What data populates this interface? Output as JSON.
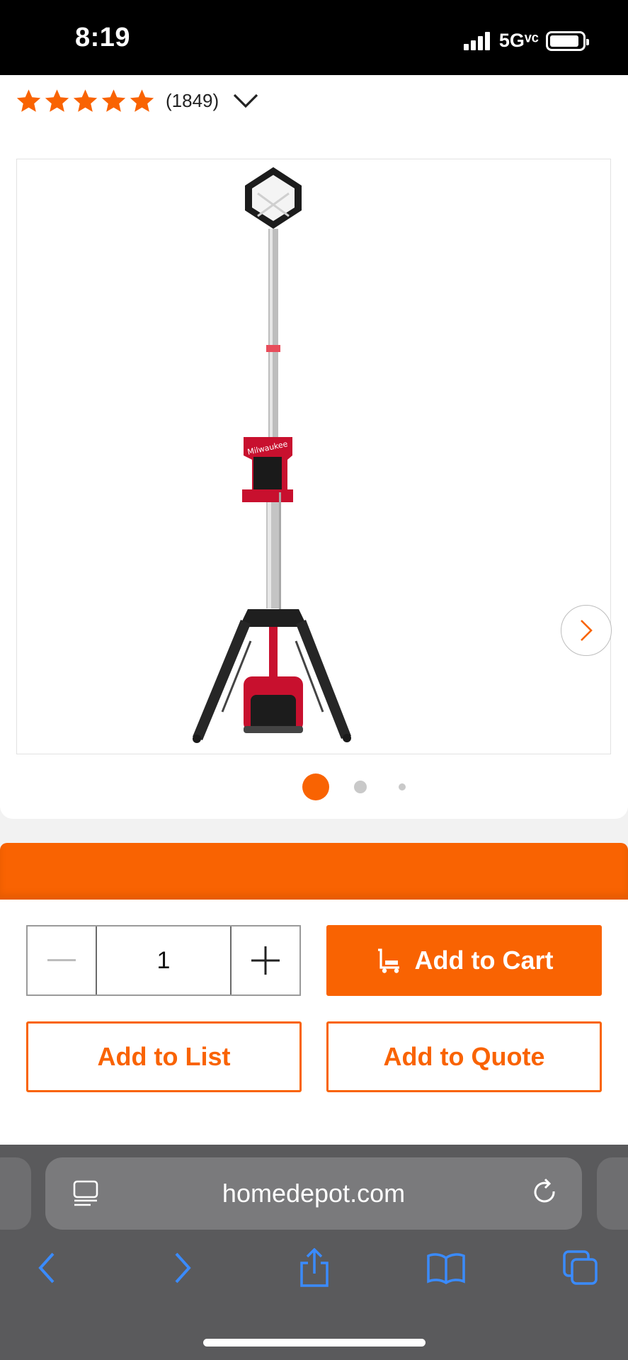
{
  "status_bar": {
    "time": "8:19",
    "network": "5Gᵛᶜ",
    "battery_level": 0.9
  },
  "product": {
    "rating": {
      "stars": 5,
      "max_stars": 5,
      "count_text": "(1849)"
    },
    "image": {
      "current": 1,
      "total": 3
    }
  },
  "purchase": {
    "quantity": "1",
    "add_to_cart_label": "Add to Cart",
    "add_to_list_label": "Add to List",
    "add_to_quote_label": "Add to Quote"
  },
  "browser": {
    "url": "homedepot.com"
  },
  "colors": {
    "brand_orange": "#f96302",
    "accent_blue": "#3a8bff",
    "toolbar_gray": "#5a5a5c"
  },
  "icons": [
    "reader-icon",
    "reload-icon",
    "back-icon",
    "forward-icon",
    "share-icon",
    "bookmarks-icon",
    "tabs-icon",
    "cart-icon",
    "chevron-down-icon",
    "chevron-right-icon",
    "minus-icon",
    "plus-icon"
  ]
}
